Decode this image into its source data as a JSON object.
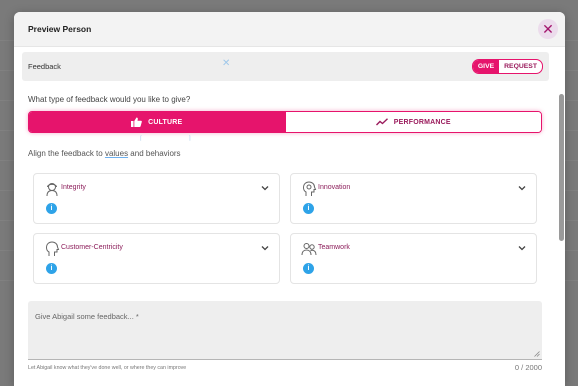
{
  "modal": {
    "title": "Preview Person",
    "close_icon": "close-icon"
  },
  "feedback_bar": {
    "label": "Feedback",
    "give_label": "GIVE",
    "request_label": "REQUEST"
  },
  "question": "What type of feedback would you like to give?",
  "types": {
    "culture_label": "CULTURE",
    "culture_icon": "thumbs-up-icon",
    "performance_label": "PERFORMANCE",
    "performance_icon": "trend-line-icon"
  },
  "align_prompt_pre": "Align the feedback to ",
  "align_prompt_link": "values",
  "align_prompt_post": " and behaviors",
  "values": [
    {
      "label": "Integrity",
      "icon": "person-headset-icon"
    },
    {
      "label": "Innovation",
      "icon": "head-gear-icon"
    },
    {
      "label": "Customer-Centricity",
      "icon": "head-profile-icon"
    },
    {
      "label": "Teamwork",
      "icon": "people-group-icon"
    }
  ],
  "textarea": {
    "placeholder": "Give Abigail some feedback... *",
    "helper": "Let Abigail know what they've done well, or where they can improve",
    "counter": "0 / 2000"
  },
  "colors": {
    "accent": "#e6146c",
    "accent_dark": "#9a1b5c",
    "info": "#2ea3e8"
  }
}
